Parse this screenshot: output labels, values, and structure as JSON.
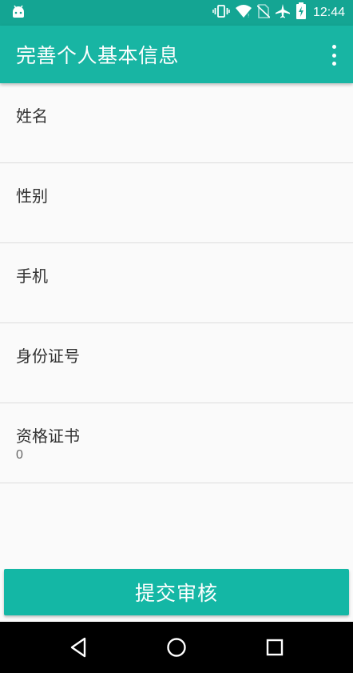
{
  "status_bar": {
    "time": "12:44",
    "icons": [
      "android-icon",
      "vibrate-icon",
      "wifi-icon",
      "no-sim-icon",
      "airplane-icon",
      "battery-charging-icon"
    ]
  },
  "app_bar": {
    "title": "完善个人基本信息",
    "menu_icon": "more-vert-icon"
  },
  "form": {
    "fields": [
      {
        "label": "姓名",
        "value": ""
      },
      {
        "label": "性别",
        "value": ""
      },
      {
        "label": "手机",
        "value": ""
      },
      {
        "label": "身份证号",
        "value": ""
      },
      {
        "label": "资格证书",
        "value": "0"
      }
    ]
  },
  "submit": {
    "label": "提交审核"
  },
  "nav_bar": {
    "icons": [
      "back-icon",
      "home-icon",
      "recents-icon"
    ]
  },
  "colors": {
    "primary": "#18b5a3",
    "status_bar": "#14a593",
    "button": "#14b7a5"
  }
}
